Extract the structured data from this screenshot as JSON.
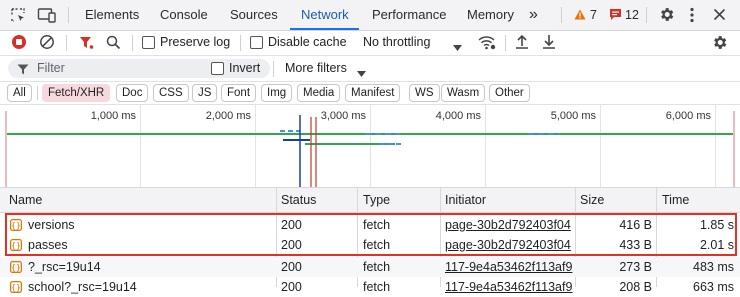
{
  "tabs": [
    {
      "label": "Elements"
    },
    {
      "label": "Console"
    },
    {
      "label": "Sources"
    },
    {
      "label": "Network"
    },
    {
      "label": "Performance"
    },
    {
      "label": "Memory"
    }
  ],
  "more_tabs": "»",
  "badges": {
    "warnings": "7",
    "errors": "12"
  },
  "toolbar": {
    "preserve_log": "Preserve log",
    "disable_cache": "Disable cache",
    "throttling": "No throttling"
  },
  "filter": {
    "placeholder": "Filter",
    "invert": "Invert",
    "more_filters": "More filters"
  },
  "type_filters": [
    "All",
    "Fetch/XHR",
    "Doc",
    "CSS",
    "JS",
    "Font",
    "Img",
    "Media",
    "Manifest",
    "WS",
    "Wasm",
    "Other"
  ],
  "active_type_filter": "Fetch/XHR",
  "timeline_ticks": [
    "1,000 ms",
    "2,000 ms",
    "3,000 ms",
    "4,000 ms",
    "5,000 ms",
    "6,000 ms"
  ],
  "columns": [
    "Name",
    "Status",
    "Type",
    "Initiator",
    "Size",
    "Time"
  ],
  "rows": [
    {
      "name": "versions",
      "status": "200",
      "type": "fetch",
      "initiator": "page-30b2d792403f04",
      "size": "416 B",
      "time": "1.85 s"
    },
    {
      "name": "passes",
      "status": "200",
      "type": "fetch",
      "initiator": "page-30b2d792403f04",
      "size": "433 B",
      "time": "2.01 s"
    },
    {
      "name": "?_rsc=19u14",
      "status": "200",
      "type": "fetch",
      "initiator": "117-9e4a53462f113af9",
      "size": "273 B",
      "time": "483 ms"
    },
    {
      "name": "school?_rsc=19u14",
      "status": "200",
      "type": "fetch",
      "initiator": "117-9e4a53462f113af9",
      "size": "208 B",
      "time": "663 ms"
    }
  ],
  "colors": {
    "accent": "#1a73e8",
    "record": "#d93025",
    "highlight": "#e53022",
    "fetch_icon": "#e37400"
  }
}
